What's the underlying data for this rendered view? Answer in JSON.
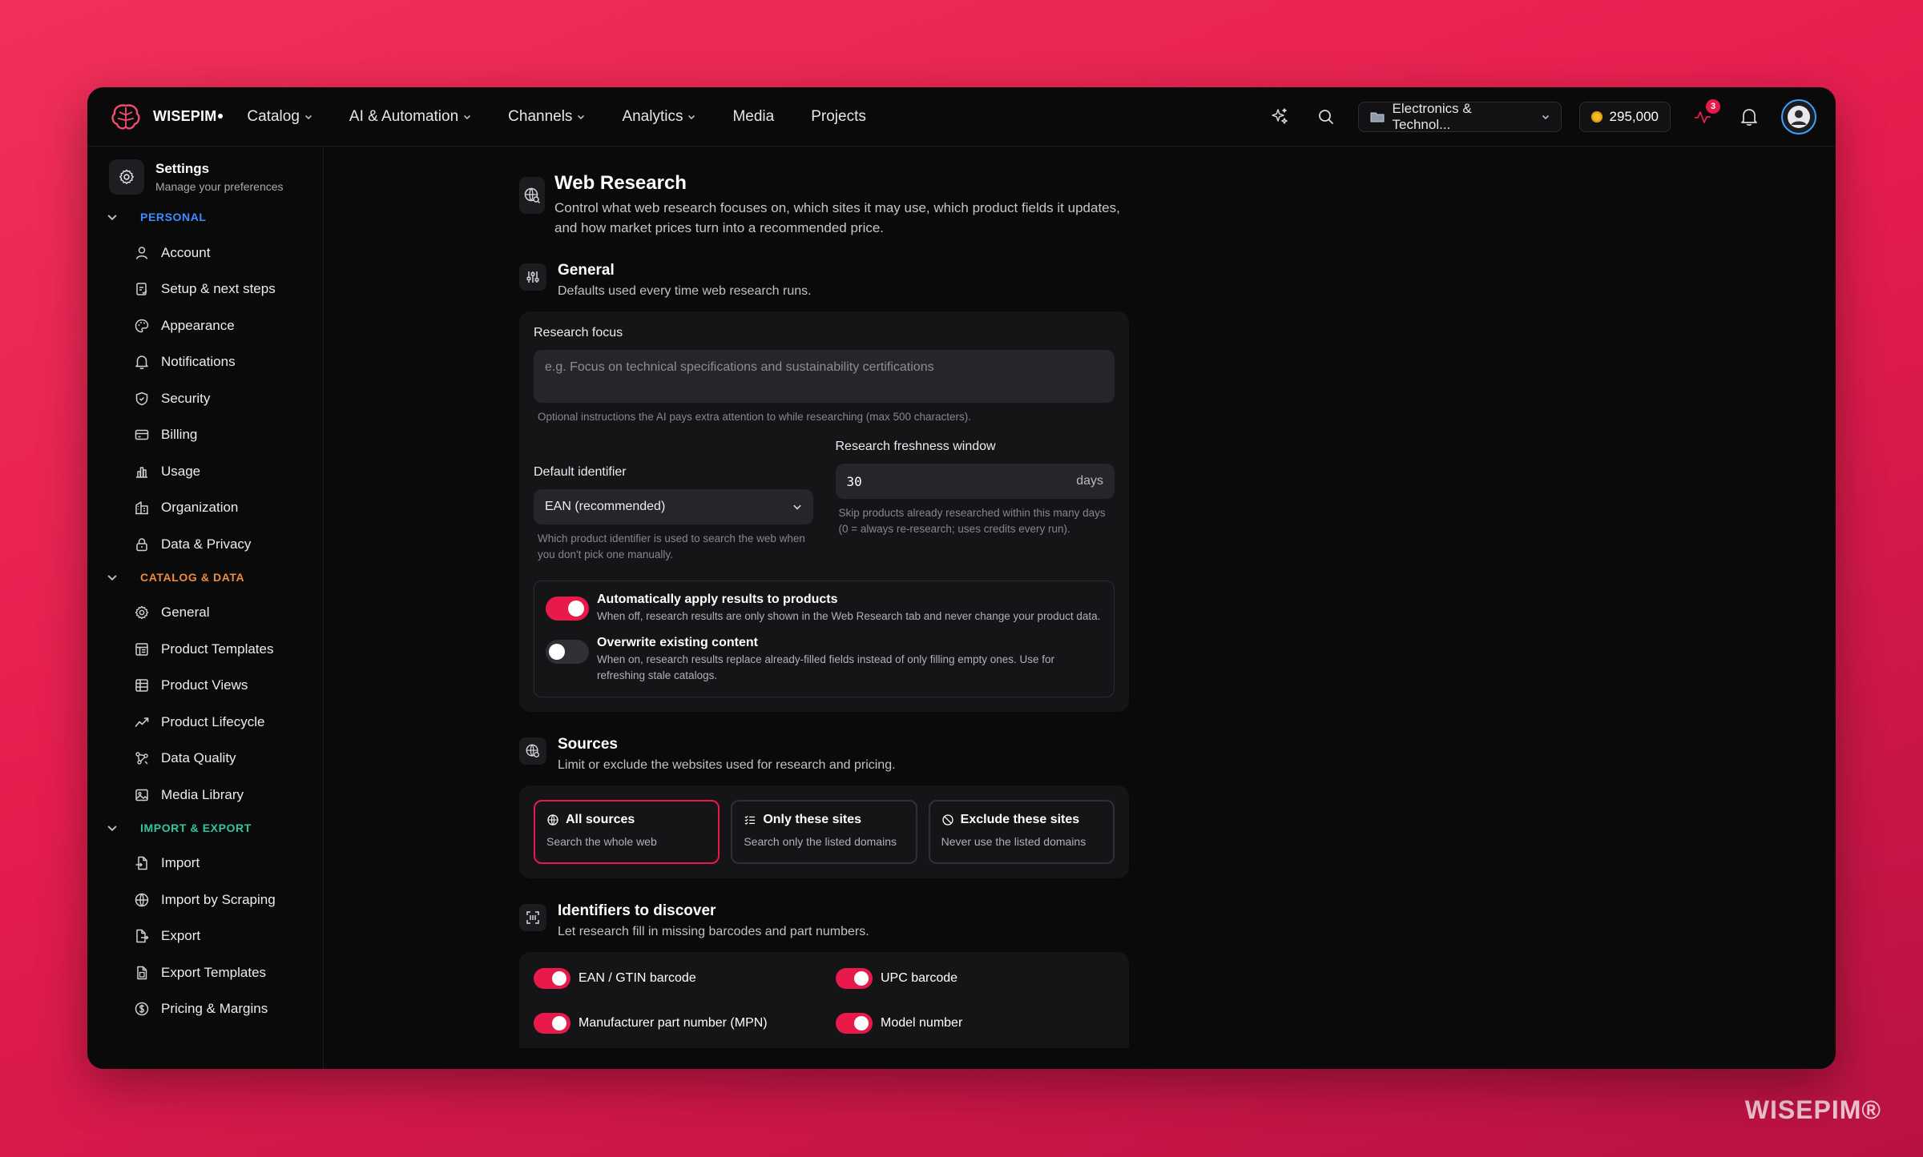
{
  "brand": {
    "name": "WISEPIM",
    "watermark": "WISEPIM®"
  },
  "nav": [
    {
      "label": "Catalog",
      "dropdown": true
    },
    {
      "label": "AI & Automation",
      "dropdown": true
    },
    {
      "label": "Channels",
      "dropdown": true
    },
    {
      "label": "Analytics",
      "dropdown": true
    },
    {
      "label": "Media",
      "dropdown": false
    },
    {
      "label": "Projects",
      "dropdown": false
    }
  ],
  "topbar": {
    "workspace": "Electronics & Technol...",
    "credits": "295,000",
    "alerts_badge": "3"
  },
  "sidebar": {
    "title": "Settings",
    "subtitle": "Manage your preferences",
    "sections": [
      {
        "label": "PERSONAL",
        "color": "#3f8cff",
        "items": [
          "Account",
          "Setup & next steps",
          "Appearance",
          "Notifications",
          "Security",
          "Billing",
          "Usage",
          "Organization",
          "Data & Privacy"
        ]
      },
      {
        "label": "CATALOG & DATA",
        "color": "#f08a3c",
        "items": [
          "General",
          "Product Templates",
          "Product Views",
          "Product Lifecycle",
          "Data Quality",
          "Media Library"
        ]
      },
      {
        "label": "IMPORT & EXPORT",
        "color": "#33c4a0",
        "items": [
          "Import",
          "Import by Scraping",
          "Export",
          "Export Templates",
          "Pricing & Margins"
        ]
      }
    ]
  },
  "page": {
    "title": "Web Research",
    "description": "Control what web research focuses on, which sites it may use, which product fields it updates, and how market prices turn into a recommended price."
  },
  "general": {
    "title": "General",
    "description": "Defaults used every time web research runs.",
    "focus_label": "Research focus",
    "focus_placeholder": "e.g. Focus on technical specifications and sustainability certifications",
    "focus_hint": "Optional instructions the AI pays extra attention to while researching (max 500 characters).",
    "identifier_label": "Default identifier",
    "identifier_value": "EAN (recommended)",
    "identifier_hint": "Which product identifier is used to search the web when you don't pick one manually.",
    "freshness_label": "Research freshness window",
    "freshness_value": "30",
    "freshness_unit": "days",
    "freshness_hint": "Skip products already researched within this many days (0 = always re-research; uses credits every run).",
    "auto_apply_title": "Automatically apply results to products",
    "auto_apply_desc": "When off, research results are only shown in the Web Research tab and never change your product data.",
    "auto_apply_on": true,
    "overwrite_title": "Overwrite existing content",
    "overwrite_desc": "When on, research results replace already-filled fields instead of only filling empty ones. Use for refreshing stale catalogs.",
    "overwrite_on": false
  },
  "sources": {
    "title": "Sources",
    "description": "Limit or exclude the websites used for research and pricing.",
    "options": [
      {
        "title": "All sources",
        "desc": "Search the whole web",
        "icon": "globe-icon",
        "selected": true
      },
      {
        "title": "Only these sites",
        "desc": "Search only the listed domains",
        "icon": "list-check-icon",
        "selected": false
      },
      {
        "title": "Exclude these sites",
        "desc": "Never use the listed domains",
        "icon": "ban-icon",
        "selected": false
      }
    ]
  },
  "identifiers": {
    "title": "Identifiers to discover",
    "description": "Let research fill in missing barcodes and part numbers.",
    "items": [
      {
        "label": "EAN / GTIN barcode",
        "on": true
      },
      {
        "label": "UPC barcode",
        "on": true
      },
      {
        "label": "Manufacturer part number (MPN)",
        "on": true
      },
      {
        "label": "Model number",
        "on": true
      }
    ]
  },
  "colors": {
    "accent": "#e8194b",
    "background": "#0a0a0b",
    "card": "#151518"
  }
}
